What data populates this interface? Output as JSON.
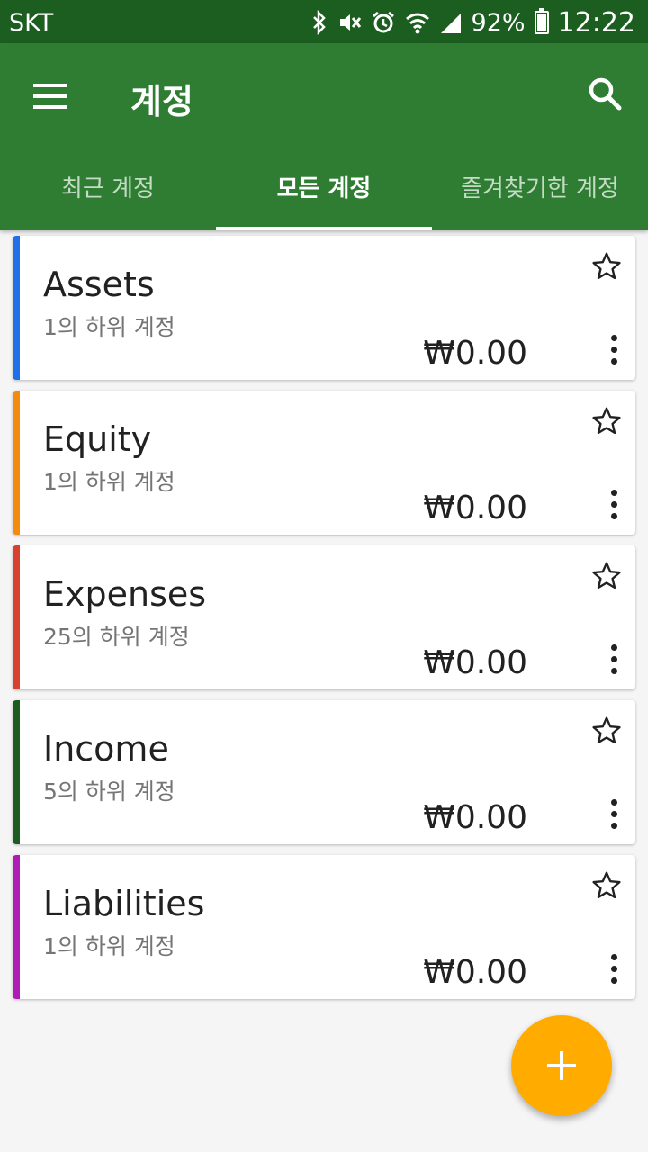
{
  "status_bar": {
    "carrier": "SKT",
    "battery": "92%",
    "time": "12:22",
    "icons": [
      "bluetooth-icon",
      "vibrate-mute-icon",
      "alarm-icon",
      "wifi-icon",
      "signal-icon",
      "battery-icon"
    ]
  },
  "app_bar": {
    "title": "계정",
    "menu_icon": "menu-icon",
    "search_icon": "search-icon",
    "color": "#2e7d32",
    "status_color": "#1b5e20"
  },
  "tabs": [
    {
      "label": "최근 계정",
      "active": false
    },
    {
      "label": "모든 계정",
      "active": true
    },
    {
      "label": "즐겨찾기한 계정",
      "active": false
    }
  ],
  "accounts": [
    {
      "name": "Assets",
      "subaccounts": "1의 하위 계정",
      "balance": "₩0.00",
      "color": "#1e6fe8"
    },
    {
      "name": "Equity",
      "subaccounts": "1의 하위 계정",
      "balance": "₩0.00",
      "color": "#f48a0e"
    },
    {
      "name": "Expenses",
      "subaccounts": "25의 하위 계정",
      "balance": "₩0.00",
      "color": "#d8412f"
    },
    {
      "name": "Income",
      "subaccounts": "5의 하위 계정",
      "balance": "₩0.00",
      "color": "#1e5b1e"
    },
    {
      "name": "Liabilities",
      "subaccounts": "1의 하위 계정",
      "balance": "₩0.00",
      "color": "#b01ab5"
    }
  ],
  "fab": {
    "icon": "plus-icon",
    "color": "#ffab00"
  }
}
